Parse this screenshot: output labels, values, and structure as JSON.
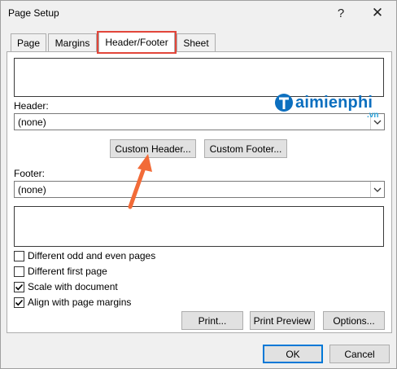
{
  "window": {
    "title": "Page Setup"
  },
  "titlebar": {
    "help_glyph": "?",
    "close_glyph": "✕"
  },
  "tabs": [
    {
      "label": "Page",
      "accel_index": 0
    },
    {
      "label": "Margins",
      "accel_index": 0
    },
    {
      "label": "Header/Footer",
      "accel_index": 0,
      "active": true
    },
    {
      "label": "Sheet",
      "accel_index": 0
    }
  ],
  "header": {
    "label": "Header:",
    "value": "(none)"
  },
  "footer": {
    "label": "Footer:",
    "value": "(none)"
  },
  "buttons": {
    "custom_header": "Custom Header...",
    "custom_footer": "Custom Footer...",
    "print": "Print...",
    "print_preview": "Print Preview",
    "options": "Options...",
    "ok": "OK",
    "cancel": "Cancel"
  },
  "options": [
    {
      "label": "Different odd and even pages",
      "checked": false
    },
    {
      "label": "Different first page",
      "checked": false
    },
    {
      "label": "Scale with document",
      "checked": true
    },
    {
      "label": "Align with page margins",
      "checked": true
    }
  ],
  "watermark": {
    "name": "aimienphi",
    "suffix": ".vn"
  },
  "colors": {
    "highlight": "#e2463a",
    "arrow": "#f26b38",
    "accent": "#0078d7"
  }
}
